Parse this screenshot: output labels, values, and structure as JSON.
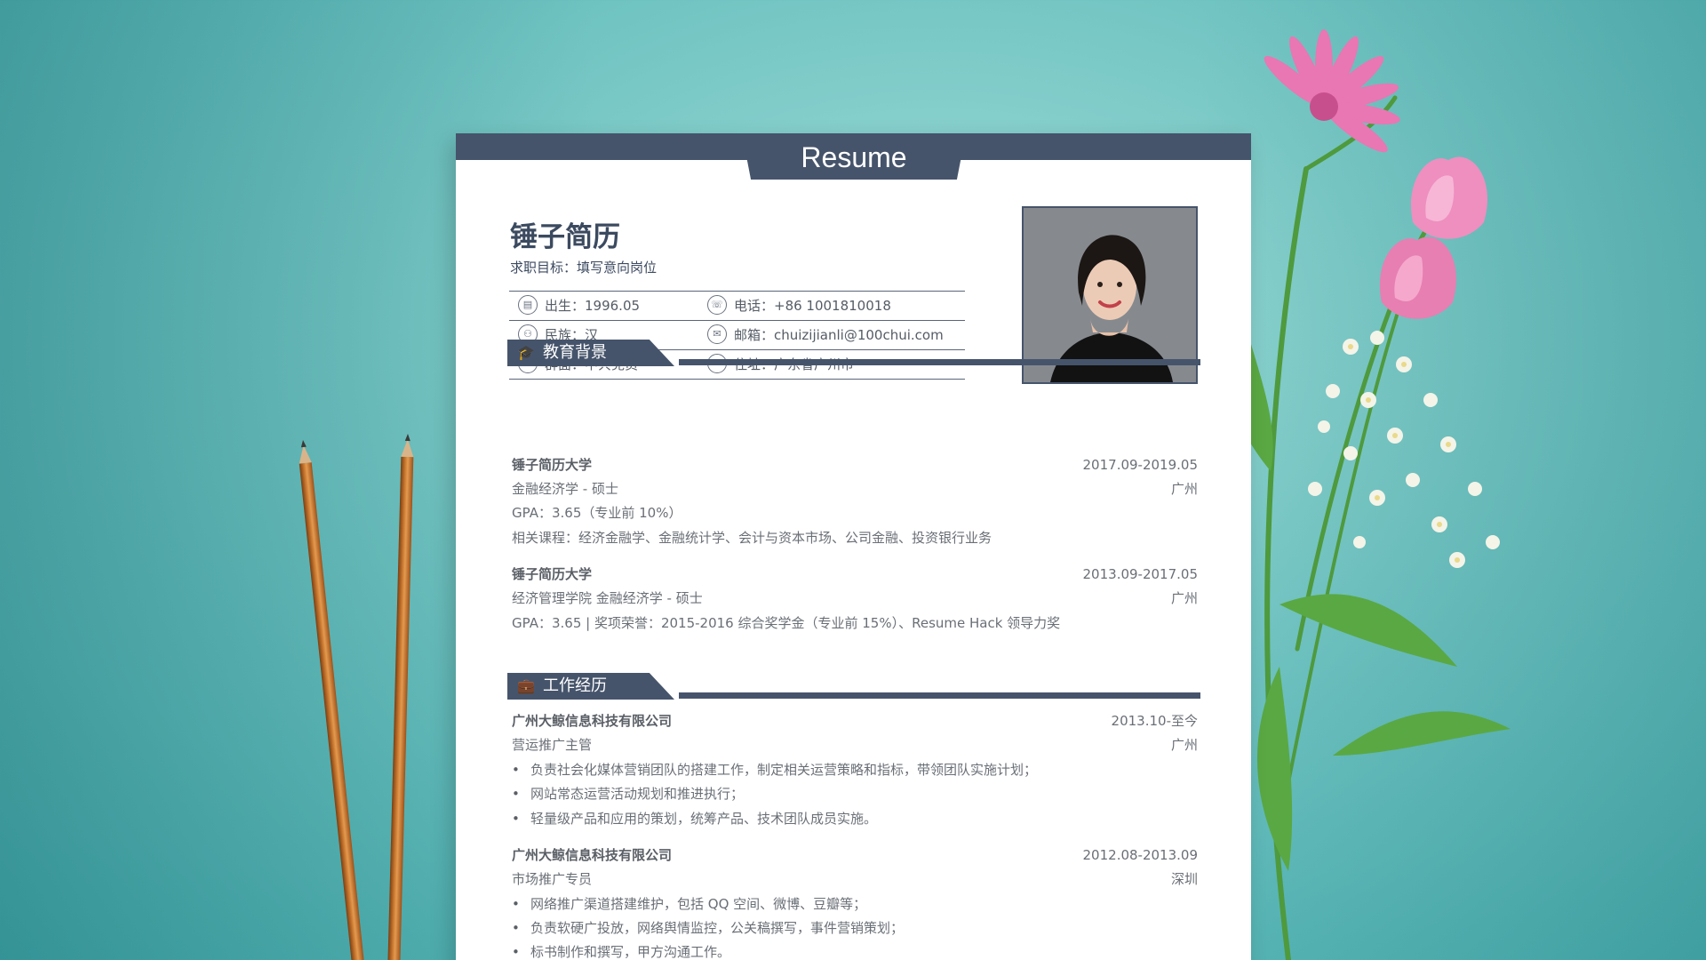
{
  "resume": {
    "header_title": "Resume",
    "name": "锤子简历",
    "objective": "求职目标：填写意向岗位",
    "info": {
      "birth": "出生：1996.05",
      "phone": "电话：+86 1001810018",
      "ethnicity": "民族：汉",
      "email": "邮箱：chuizijianli@100chui.com",
      "politics": "群面：中共党员",
      "address": "住址：广东省广州市"
    },
    "education": {
      "heading": "教育背景",
      "entries": [
        {
          "school": "锤子简历大学",
          "dates": "2017.09-2019.05",
          "major": "金融经济学 - 硕士",
          "location": "广州",
          "gpa": "GPA：3.65（专业前 10%）",
          "courses": "相关课程：经济金融学、金融统计学、会计与资本市场、公司金融、投资银行业务"
        },
        {
          "school": "锤子简历大学",
          "dates": "2013.09-2017.05",
          "major": "经济管理学院 金融经济学 - 硕士",
          "location": "广州",
          "gpa": "GPA：3.65 | 奖项荣誉：2015-2016 综合奖学金（专业前 15%）、Resume Hack 领导力奖"
        }
      ]
    },
    "work": {
      "heading": "工作经历",
      "entries": [
        {
          "company": "广州大鲸信息科技有限公司",
          "dates": "2013.10-至今",
          "title": "营运推广主管",
          "location": "广州",
          "bullets": [
            "负责社会化媒体营销团队的搭建工作，制定相关运营策略和指标，带领团队实施计划；",
            "网站常态运营活动规划和推进执行；",
            "轻量级产品和应用的策划，统筹产品、技术团队成员实施。"
          ]
        },
        {
          "company": "广州大鲸信息科技有限公司",
          "dates": "2012.08-2013.09",
          "title": "市场推广专员",
          "location": "深圳",
          "bullets": [
            "网络推广渠道搭建维护，包括 QQ 空间、微博、豆瓣等；",
            "负责软硬广投放，网络舆情监控，公关稿撰写，事件营销策划；",
            "标书制作和撰写，甲方沟通工作。"
          ]
        }
      ]
    }
  },
  "colors": {
    "accent": "#46546b",
    "background": "#6fc3c1"
  }
}
